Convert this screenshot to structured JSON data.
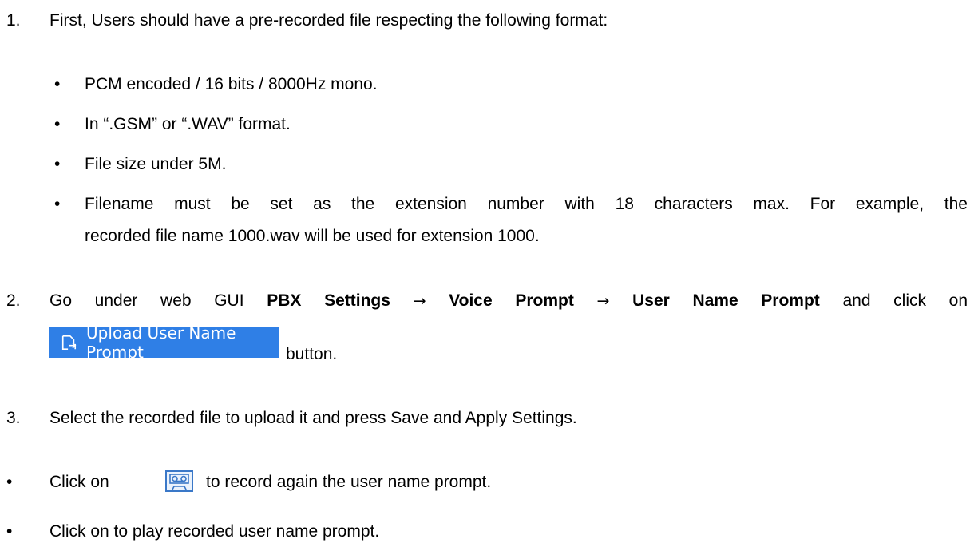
{
  "steps": {
    "step1": {
      "number": "1.",
      "text": "First, Users should have a pre-recorded file respecting the following format:",
      "bullets": [
        "PCM encoded / 16 bits / 8000Hz mono.",
        "In “.GSM” or “.WAV” format.",
        "File size under 5M.",
        "Filename must be set as the extension number with 18 characters max. For example, the",
        "recorded file name 1000.wav will be used for extension 1000."
      ]
    },
    "step2": {
      "number": "2.",
      "prefix": "Go under web GUI",
      "path1": "PBX Settings",
      "path2": "Voice Prompt",
      "path3": "User Name Prompt",
      "suffix": "and click on",
      "button_label": "Upload User Name Prompt",
      "after_button": "button."
    },
    "step3": {
      "number": "3.",
      "text": "Select the recorded file to upload it and press Save and Apply Settings."
    },
    "notes": {
      "record_prefix": "Click on",
      "record_suffix": "to record again the user name prompt.",
      "play_text": "Click on to play recorded user name prompt."
    }
  },
  "symbols": {
    "bullet": "•",
    "arrow": "→"
  },
  "icons": {
    "upload": "upload-file-icon",
    "record": "cassette-tape-icon"
  },
  "colors": {
    "button_bg": "#2f7fe6",
    "button_text": "#ffffff",
    "icon_blue": "#3a78c8"
  }
}
